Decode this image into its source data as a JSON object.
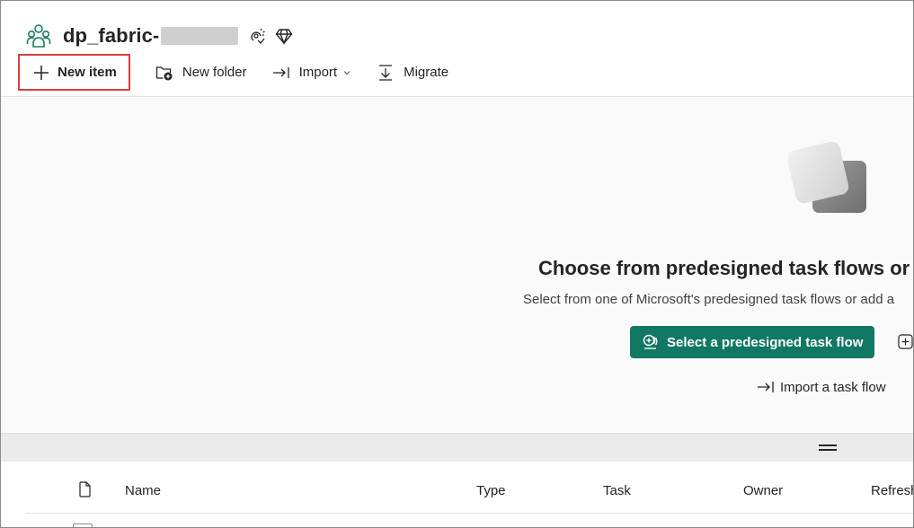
{
  "workspace": {
    "name": "dp_fabric-",
    "icon": "workspace-people-icon",
    "badges": [
      "workspace-identity-icon",
      "premium-diamond-icon"
    ]
  },
  "toolbar": {
    "new_item": "New item",
    "new_folder": "New folder",
    "import": "Import",
    "migrate": "Migrate"
  },
  "hero": {
    "title": "Choose from predesigned task flows or a",
    "subtitle": "Select from one of Microsoft's predesigned task flows or add a",
    "primary_button": "Select a predesigned task flow",
    "import_link": "Import a task flow"
  },
  "table": {
    "columns": [
      "Name",
      "Type",
      "Task",
      "Owner",
      "Refresh"
    ]
  },
  "colors": {
    "accent": "#117865",
    "highlight_border": "#d9403a",
    "workspace_icon": "#1a7f5a"
  }
}
